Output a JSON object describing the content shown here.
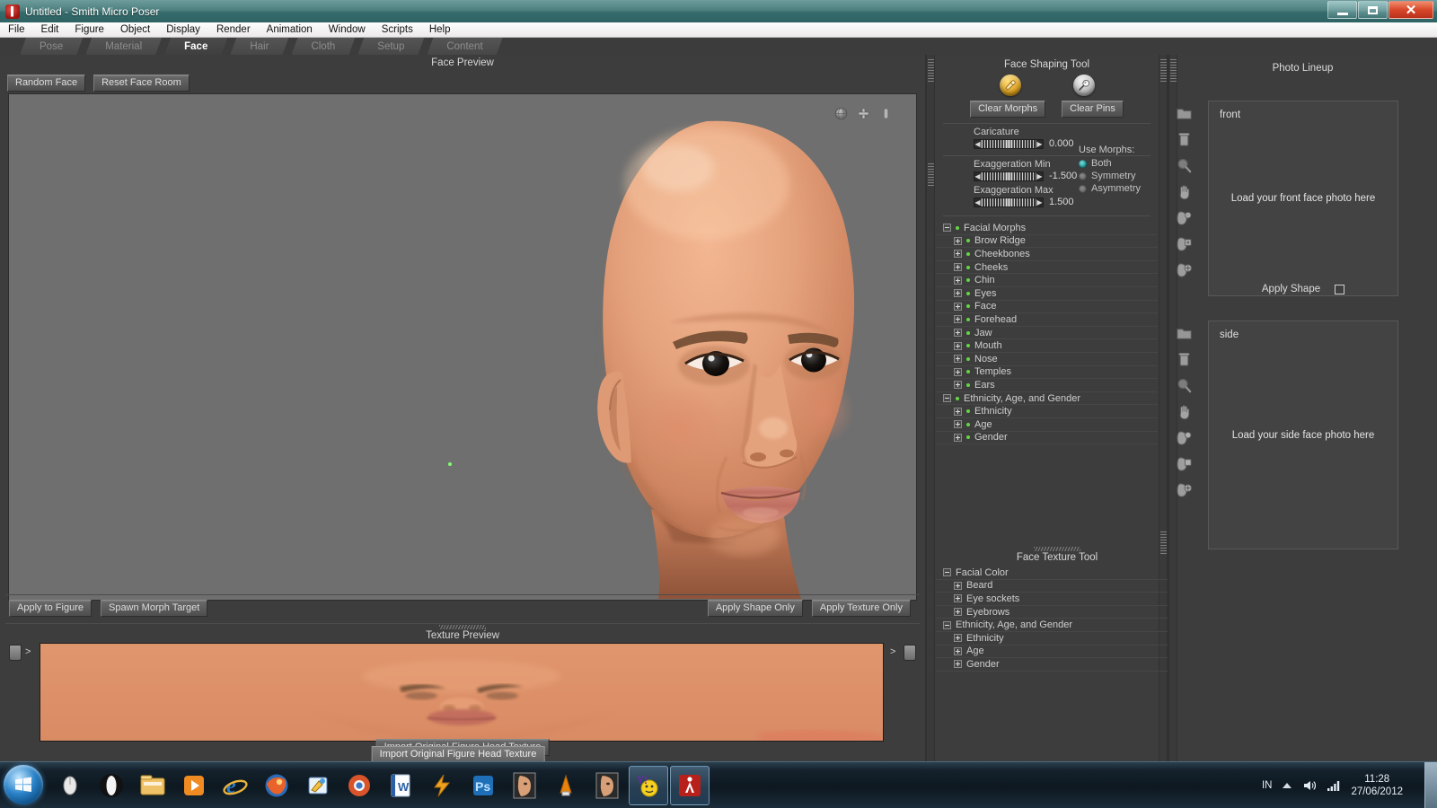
{
  "window": {
    "title": "Untitled - Smith Micro Poser",
    "app_icon": "poser-icon",
    "controls": {
      "minimize": "minimize-icon",
      "maximize": "maximize-icon",
      "close": "close-icon"
    }
  },
  "menubar": {
    "items": [
      "File",
      "Edit",
      "Figure",
      "Object",
      "Display",
      "Render",
      "Animation",
      "Window",
      "Scripts",
      "Help"
    ]
  },
  "room_tabs": {
    "items": [
      {
        "label": "Pose",
        "active": false
      },
      {
        "label": "Material",
        "active": false
      },
      {
        "label": "Face",
        "active": true
      },
      {
        "label": "Hair",
        "active": false
      },
      {
        "label": "Cloth",
        "active": false
      },
      {
        "label": "Setup",
        "active": false
      },
      {
        "label": "Content",
        "active": false
      }
    ]
  },
  "face_preview": {
    "title": "Face Preview",
    "buttons": {
      "random_face": "Random Face",
      "reset_face_room": "Reset Face Room"
    },
    "viewport_icons": [
      "rotate-sphere-icon",
      "move-cross-icon",
      "zoom-icon"
    ],
    "bottom_left_buttons": [
      "Apply to Figure",
      "Spawn Morph Target"
    ],
    "bottom_right_buttons": [
      "Apply Shape Only",
      "Apply Texture Only"
    ]
  },
  "texture_preview": {
    "title": "Texture Preview",
    "import_button": "Import Original Figure Head Texture",
    "left_arrow": ">",
    "right_arrow": ">"
  },
  "face_shaping_tool": {
    "title": "Face Shaping Tool",
    "morph_orb_icon": "morph-brush-icon",
    "pin_orb_icon": "pin-icon",
    "clear_morphs_button": "Clear  Morphs",
    "clear_pins_button": "Clear  Pins",
    "parameters": [
      {
        "label": "Caricature",
        "value": "0.000"
      },
      {
        "label": "Exaggeration Min",
        "value": "-1.500"
      },
      {
        "label": "Exaggeration Max",
        "value": "1.500"
      }
    ],
    "use_morphs": {
      "title": "Use Morphs:",
      "options": [
        {
          "label": "Both",
          "selected": true
        },
        {
          "label": "Symmetry",
          "selected": false
        },
        {
          "label": "Asymmetry",
          "selected": false
        }
      ]
    },
    "tree": [
      {
        "label": "Facial Morphs",
        "expanded": true,
        "indent": 0,
        "dot": true
      },
      {
        "label": "Brow Ridge",
        "expanded": false,
        "indent": 1,
        "dot": true
      },
      {
        "label": "Cheekbones",
        "expanded": false,
        "indent": 1,
        "dot": true
      },
      {
        "label": "Cheeks",
        "expanded": false,
        "indent": 1,
        "dot": true
      },
      {
        "label": "Chin",
        "expanded": false,
        "indent": 1,
        "dot": true
      },
      {
        "label": "Eyes",
        "expanded": false,
        "indent": 1,
        "dot": true
      },
      {
        "label": "Face",
        "expanded": false,
        "indent": 1,
        "dot": true
      },
      {
        "label": "Forehead",
        "expanded": false,
        "indent": 1,
        "dot": true
      },
      {
        "label": "Jaw",
        "expanded": false,
        "indent": 1,
        "dot": true
      },
      {
        "label": "Mouth",
        "expanded": false,
        "indent": 1,
        "dot": true
      },
      {
        "label": "Nose",
        "expanded": false,
        "indent": 1,
        "dot": true
      },
      {
        "label": "Temples",
        "expanded": false,
        "indent": 1,
        "dot": true
      },
      {
        "label": "Ears",
        "expanded": false,
        "indent": 1,
        "dot": true
      },
      {
        "label": "Ethnicity, Age, and Gender",
        "expanded": true,
        "indent": 0,
        "dot": true
      },
      {
        "label": "Ethnicity",
        "expanded": false,
        "indent": 1,
        "dot": true
      },
      {
        "label": "Age",
        "expanded": false,
        "indent": 1,
        "dot": true
      },
      {
        "label": "Gender",
        "expanded": false,
        "indent": 1,
        "dot": true
      }
    ]
  },
  "face_texture_tool": {
    "title": "Face Texture Tool",
    "tree": [
      {
        "label": "Facial Color",
        "expanded": true,
        "indent": 0,
        "dot": false
      },
      {
        "label": "Beard",
        "expanded": false,
        "indent": 1,
        "dot": false
      },
      {
        "label": "Eye sockets",
        "expanded": false,
        "indent": 1,
        "dot": false
      },
      {
        "label": "Eyebrows",
        "expanded": false,
        "indent": 1,
        "dot": false
      },
      {
        "label": "Ethnicity, Age, and Gender",
        "expanded": true,
        "indent": 0,
        "dot": false
      },
      {
        "label": "Ethnicity",
        "expanded": false,
        "indent": 1,
        "dot": false
      },
      {
        "label": "Age",
        "expanded": false,
        "indent": 1,
        "dot": false
      },
      {
        "label": "Gender",
        "expanded": false,
        "indent": 1,
        "dot": false
      }
    ]
  },
  "photo_lineup": {
    "title": "Photo Lineup",
    "tool_icons": [
      "folder-icon",
      "trash-icon",
      "magnifier-icon",
      "hand-icon",
      "head-morph-icon",
      "head-pin-icon",
      "head-move-icon"
    ],
    "front": {
      "label": "front",
      "hint": "Load your front face photo here"
    },
    "apply_shape": {
      "label": "Apply Shape",
      "checked": false
    },
    "side": {
      "label": "side",
      "hint": "Load your side face photo here"
    }
  },
  "taskbar": {
    "start_icon": "windows-start-icon",
    "items": [
      "mouse-icon",
      "opera-icon",
      "explorer-folder-icon",
      "media-player-icon",
      "internet-explorer-icon",
      "firefox-icon",
      "paint-icon",
      "chrome-icon",
      "word-icon",
      "flash-icon",
      "photoshop-icon",
      "poser-face-icon",
      "vlc-icon",
      "poser-face2-icon",
      "yahoo-messenger-icon",
      "poser-icon"
    ],
    "tray": {
      "language": "IN",
      "up_arrow": "show-hidden-icons-arrow",
      "volume": "volume-icon",
      "network": "network-icon"
    },
    "clock": {
      "time": "11:28",
      "date": "27/06/2012"
    }
  },
  "colors": {
    "panel_bg": "#3d3d3d",
    "viewport_bg": "#6f6f6f",
    "accent_teal": "#179a9a",
    "tree_dot_green": "#63d644",
    "skin": "#dd9269"
  }
}
